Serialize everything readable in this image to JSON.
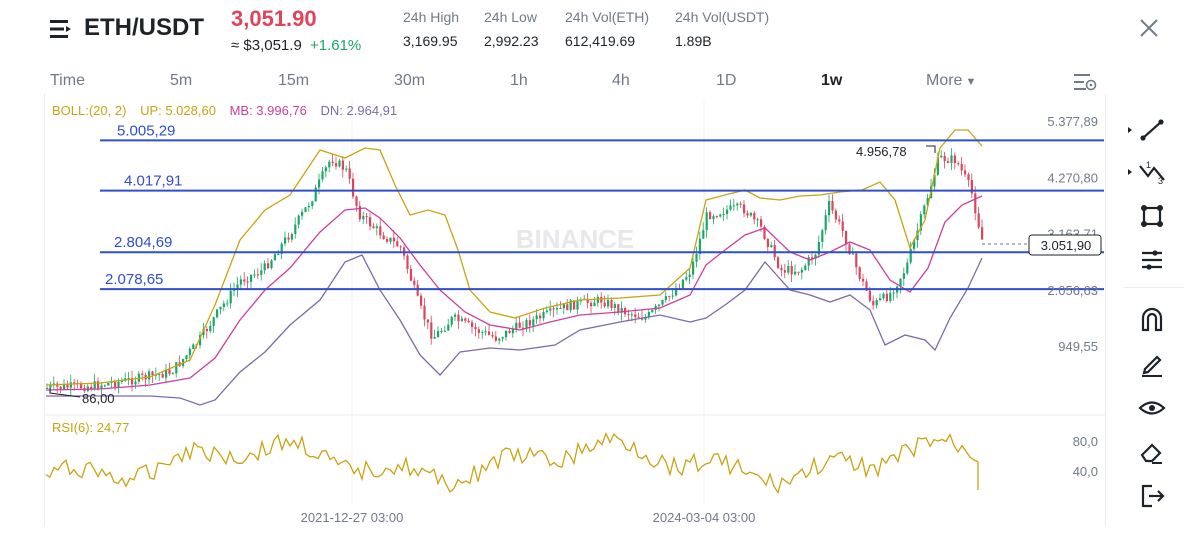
{
  "header": {
    "pair": "ETH/USDT",
    "last_price": "3,051.90",
    "usd_price": "≈ $3,051.9",
    "change": "+1.61%",
    "stats": [
      {
        "label": "24h High",
        "value": "3,169.95"
      },
      {
        "label": "24h Low",
        "value": "2,992.23"
      },
      {
        "label": "24h Vol(ETH)",
        "value": "612,419.69"
      },
      {
        "label": "24h Vol(USDT)",
        "value": "1.89B"
      }
    ]
  },
  "tabs": {
    "time": "Time",
    "m5": "5m",
    "m15": "15m",
    "m30": "30m",
    "h1": "1h",
    "h4": "4h",
    "d1": "1D",
    "w1": "1w",
    "more": "More",
    "active": "1w"
  },
  "boll": {
    "title": "BOLL:(20, 2)",
    "up": "UP: 5.028,60",
    "mb": "MB: 3.996,76",
    "dn": "DN: 2.964,91"
  },
  "price_axis": [
    "5.377,89",
    "4.270,80",
    "3.163,71",
    "2.056,63",
    "949,55"
  ],
  "current_price_label": "3.051,90",
  "horizontal_levels": [
    {
      "label": "5.005,29",
      "value": 5005.29
    },
    {
      "label": "4.017,91",
      "value": 4017.91
    },
    {
      "label": "2.804,69",
      "value": 2804.69
    },
    {
      "label": "2.078,65",
      "value": 2078.65
    }
  ],
  "annotations": {
    "high": "4.956,78",
    "low": "86,00"
  },
  "watermark": "BINANCE",
  "rsi": {
    "title": "RSI(6): 24,77",
    "axis": [
      "80,0",
      "40,0"
    ]
  },
  "time_axis": [
    "2021-12-27 03:00",
    "2024-03-04 03:00"
  ],
  "colors": {
    "up": "#19a866",
    "down": "#e0445a",
    "boll_up": "#caa312",
    "boll_mb": "#cc3f9e",
    "boll_dn": "#7e6aa8",
    "level_line": "#2f4fcc",
    "rsi": "#caa312"
  },
  "toolbar": [
    "trend-line-icon",
    "multi-line-icon",
    "shape-icon",
    "fib-icon",
    "magnet-icon",
    "pencil-icon",
    "eye-icon",
    "eraser-icon",
    "exit-icon"
  ]
}
